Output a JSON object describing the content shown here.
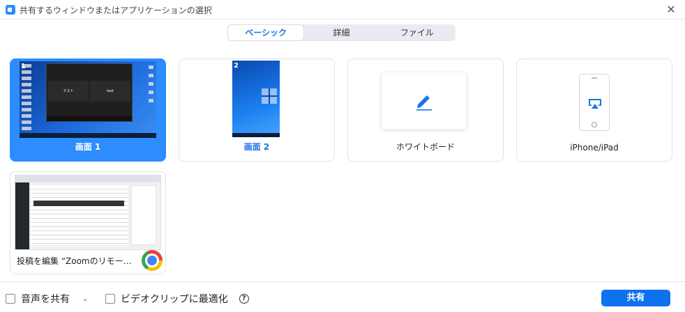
{
  "window": {
    "title": "共有するウィンドウまたはアプリケーションの選択",
    "close_glyph": "✕"
  },
  "tabs": [
    {
      "label": "ベーシック",
      "active": true
    },
    {
      "label": "詳細",
      "active": false
    },
    {
      "label": "ファイル",
      "active": false
    }
  ],
  "cards": [
    {
      "label": "画面 1",
      "badge": "1",
      "selected": true,
      "preview_tiles": [
        "テスト",
        "test"
      ]
    },
    {
      "label": "画面 2",
      "badge": "2",
      "selected": false
    },
    {
      "label": "ホワイトボード",
      "icon": "pen-icon"
    },
    {
      "label": "iPhone/iPad",
      "icon": "airplay-icon"
    },
    {
      "label": "投稿を編集 “Zoomのリモート制...",
      "icon": "chrome-icon"
    }
  ],
  "footer": {
    "share_audio": "音声を共有",
    "optimize_video": "ビデオクリップに最適化",
    "help_glyph": "?",
    "caret_glyph": "⌄",
    "share_button": "共有"
  },
  "colors": {
    "accent": "#2d8cff",
    "button": "#0e72ed",
    "active_tab_text": "#1a73e8"
  }
}
